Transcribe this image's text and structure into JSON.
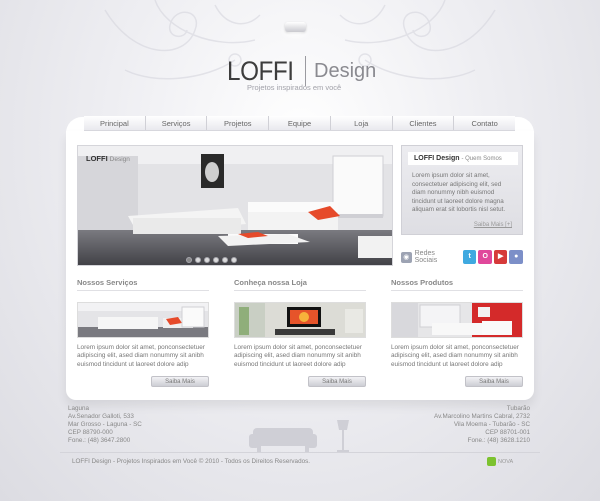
{
  "brand": {
    "name": "LOFFI",
    "sub": "Design",
    "tagline": "Projetos inspirados em você"
  },
  "nav": [
    {
      "label": "Principal"
    },
    {
      "label": "Serviços"
    },
    {
      "label": "Projetos"
    },
    {
      "label": "Equipe"
    },
    {
      "label": "Loja"
    },
    {
      "label": "Clientes"
    },
    {
      "label": "Contato"
    }
  ],
  "slider": {
    "logo_main": "LOFFI",
    "logo_sub": "Design",
    "dots": 6
  },
  "about": {
    "title": "LOFFI Design",
    "title_suffix": "- Quem Somos",
    "text": "Lorem ipsum dolor sit amet, consectetuer adipiscing elit, sed diam nonummy nibh euismod tincidunt ut laoreet dolore magna aliquam erat sit lobortis nisl setut.",
    "more": "Saiba Mais [+]"
  },
  "social": {
    "label": "Redes Sociais",
    "icons": [
      {
        "name": "twitter",
        "color": "#3fa9e0",
        "glyph": "t"
      },
      {
        "name": "orkut",
        "color": "#e0489b",
        "glyph": "O"
      },
      {
        "name": "youtube",
        "color": "#d63a3a",
        "glyph": "▶"
      },
      {
        "name": "flickr",
        "color": "#7c8fc8",
        "glyph": "●"
      }
    ]
  },
  "columns": [
    {
      "title": "Nossos Serviços",
      "text": "Lorem ipsum dolor sit amet, ponconsectetuer adipiscing elit, ased diam nonummy sit anibh euismod tincidunt ut laoreet dolore adip",
      "button": "Saiba Mais"
    },
    {
      "title": "Conheça nossa Loja",
      "text": "Lorem ipsum dolor sit amet, ponconsectetuer adipiscing elit, ased diam nonummy sit anibh euismod tincidunt ut laoreet dolore adip",
      "button": "Saiba Mais"
    },
    {
      "title": "Nossos Produtos",
      "text": "Lorem ipsum dolor sit amet, ponconsectetuer adipiscing elit, ased diam nonummy sit anibh euismod tincidunt ut laoreet dolore adip",
      "button": "Saiba Mais"
    }
  ],
  "footer": {
    "left": [
      "Laguna",
      "Av.Senador Galloti, 533",
      "Mar Grosso - Laguna - SC",
      "CEP 88790-000",
      "Fone.: (48) 3647.2800"
    ],
    "right": [
      "Tubarão",
      "Av.Marcolino Martins Cabral, 2732",
      "Vila Moema - Tubarão - SC",
      "CEP 88701-001",
      "Fone.: (48) 3628.1210"
    ],
    "copyright": "LOFFI Design - Projetos Inspirados em Você © 2010 - Todos os Direitos Reservados.",
    "badge": "NOVA"
  }
}
